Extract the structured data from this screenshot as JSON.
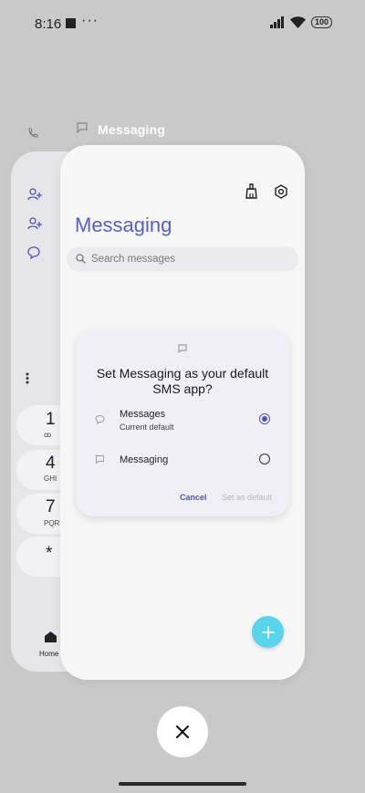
{
  "status_bar": {
    "time": "8:16",
    "more": "···",
    "battery": "100"
  },
  "background_app": {
    "dial_keys": [
      {
        "digit": "1",
        "letters": "ꝏ"
      },
      {
        "digit": "4",
        "letters": "GHI"
      },
      {
        "digit": "7",
        "letters": "PQRS"
      },
      {
        "digit": "*",
        "letters": ""
      }
    ],
    "nav_home_label": "Home"
  },
  "front_app": {
    "card_label": "Messaging",
    "title": "Messaging",
    "search_placeholder": "Search messages"
  },
  "dialog": {
    "title": "Set Messaging as your default SMS app?",
    "options": [
      {
        "label": "Messages",
        "sublabel": "Current default",
        "selected": true
      },
      {
        "label": "Messaging",
        "sublabel": "",
        "selected": false
      }
    ],
    "cancel_label": "Cancel",
    "set_default_label": "Set as default"
  },
  "colors": {
    "accent": "#5a5ec2",
    "fab": "#5ad3ed",
    "backdrop": "#c9c9c9"
  }
}
